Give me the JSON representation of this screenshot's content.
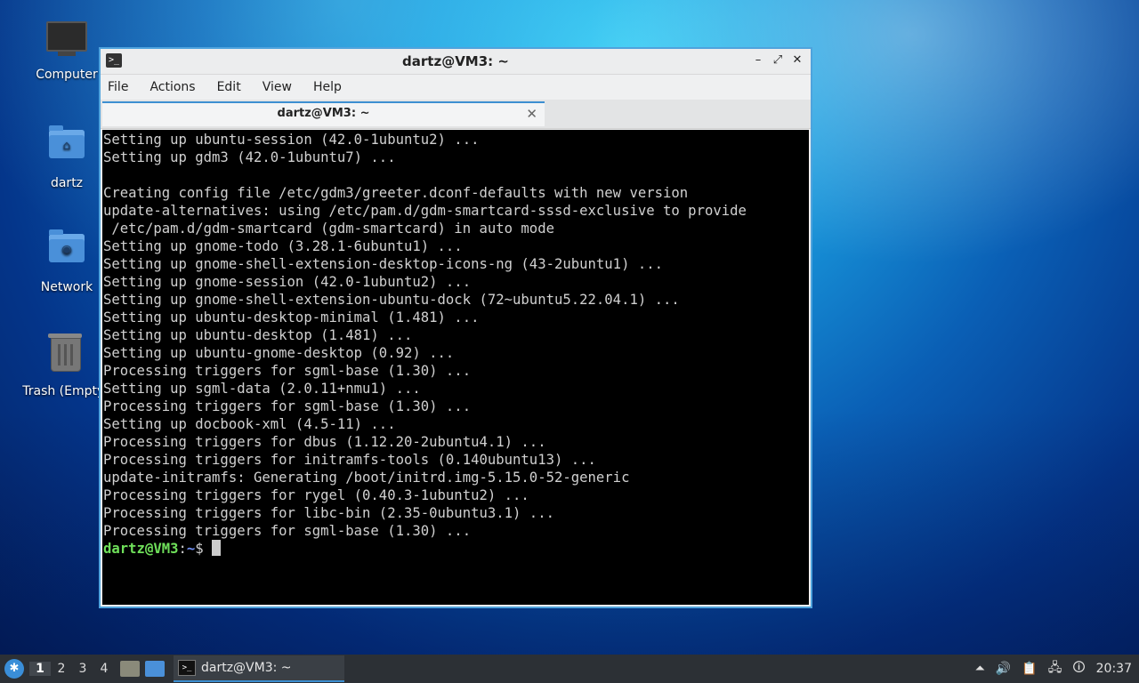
{
  "desktop": {
    "icons": [
      {
        "label": "Computer",
        "icon": "computer-icon"
      },
      {
        "label": "dartz",
        "icon": "home-folder-icon"
      },
      {
        "label": "Network",
        "icon": "network-folder-icon"
      },
      {
        "label": "Trash (Empty)",
        "icon": "trash-icon"
      }
    ]
  },
  "window": {
    "title": "dartz@VM3: ~",
    "controls": {
      "minimize": "–",
      "maximize": "⤢",
      "close": "✕"
    },
    "menu": [
      "File",
      "Actions",
      "Edit",
      "View",
      "Help"
    ],
    "tab": {
      "label": "dartz@VM3: ~",
      "close": "✕"
    }
  },
  "terminal": {
    "lines": [
      "Setting up ubuntu-session (42.0-1ubuntu2) ...",
      "Setting up gdm3 (42.0-1ubuntu7) ...",
      "",
      "Creating config file /etc/gdm3/greeter.dconf-defaults with new version",
      "update-alternatives: using /etc/pam.d/gdm-smartcard-sssd-exclusive to provide",
      " /etc/pam.d/gdm-smartcard (gdm-smartcard) in auto mode",
      "Setting up gnome-todo (3.28.1-6ubuntu1) ...",
      "Setting up gnome-shell-extension-desktop-icons-ng (43-2ubuntu1) ...",
      "Setting up gnome-session (42.0-1ubuntu2) ...",
      "Setting up gnome-shell-extension-ubuntu-dock (72~ubuntu5.22.04.1) ...",
      "Setting up ubuntu-desktop-minimal (1.481) ...",
      "Setting up ubuntu-desktop (1.481) ...",
      "Setting up ubuntu-gnome-desktop (0.92) ...",
      "Processing triggers for sgml-base (1.30) ...",
      "Setting up sgml-data (2.0.11+nmu1) ...",
      "Processing triggers for sgml-base (1.30) ...",
      "Setting up docbook-xml (4.5-11) ...",
      "Processing triggers for dbus (1.12.20-2ubuntu4.1) ...",
      "Processing triggers for initramfs-tools (0.140ubuntu13) ...",
      "update-initramfs: Generating /boot/initrd.img-5.15.0-52-generic",
      "Processing triggers for rygel (0.40.3-1ubuntu2) ...",
      "Processing triggers for libc-bin (2.35-0ubuntu3.1) ...",
      "Processing triggers for sgml-base (1.30) ..."
    ],
    "prompt_user": "dartz@VM3",
    "prompt_sep": ":",
    "prompt_path": "~",
    "prompt_symbol": "$ "
  },
  "taskbar": {
    "workspaces": [
      "1",
      "2",
      "3",
      "4"
    ],
    "active_workspace": "1",
    "task_label": "dartz@VM3: ~",
    "clock": "20:37"
  }
}
